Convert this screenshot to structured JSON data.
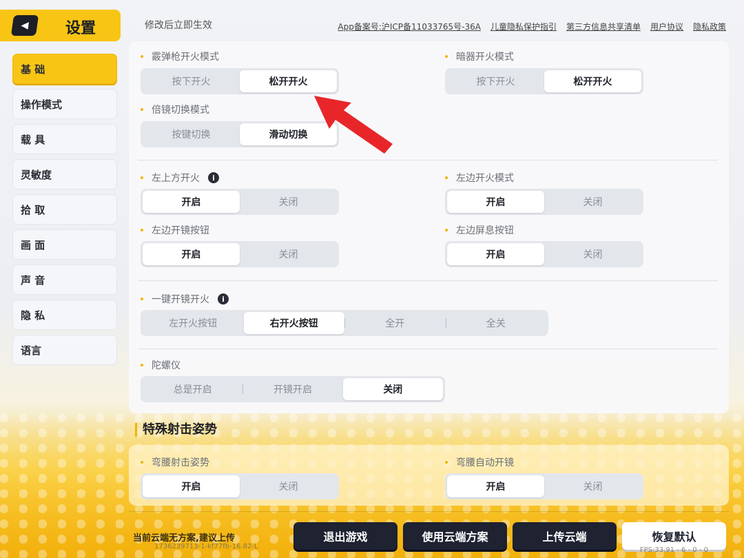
{
  "header": {
    "title": "设置",
    "hint": "修改后立即生效",
    "links": [
      "App备案号:沪ICP备11033765号-36A",
      "儿童隐私保护指引",
      "第三方信息共享清单",
      "用户协议",
      "隐私政策"
    ]
  },
  "sidebar": {
    "items": [
      "基 础",
      "操作模式",
      "载 具",
      "灵敏度",
      "拾 取",
      "画 面",
      "声 音",
      "隐 私",
      "语言"
    ],
    "active_index": 0
  },
  "settings": {
    "shotgun": {
      "label": "霰弹枪开火模式",
      "options": [
        "按下开火",
        "松开开火"
      ],
      "selected": 1
    },
    "throwable": {
      "label": "暗器开火模式",
      "options": [
        "按下开火",
        "松开开火"
      ],
      "selected": 1
    },
    "scope_switch": {
      "label": "倍镜切换模式",
      "options": [
        "按键切换",
        "滑动切换"
      ],
      "selected": 1
    },
    "top_left_fire": {
      "label": "左上方开火",
      "options": [
        "开启",
        "关闭"
      ],
      "selected": 0
    },
    "left_fire_mode": {
      "label": "左边开火模式",
      "options": [
        "开启",
        "关闭"
      ],
      "selected": 0
    },
    "left_scope_btn": {
      "label": "左边开镜按钮",
      "options": [
        "开启",
        "关闭"
      ],
      "selected": 0
    },
    "left_hold_breath": {
      "label": "左边屏息按钮",
      "options": [
        "开启",
        "关闭"
      ],
      "selected": 0
    },
    "one_tap_scope_fire": {
      "label": "一键开镜开火",
      "options": [
        "左开火按钮",
        "右开火按钮",
        "全开",
        "全关"
      ],
      "selected": 1
    },
    "gyro": {
      "label": "陀螺仪",
      "options": [
        "总是开启",
        "开镜开启",
        "关闭"
      ],
      "selected": 2
    }
  },
  "special": {
    "title": "特殊射击姿势",
    "crouch_stance": {
      "label": "弯腰射击姿势",
      "options": [
        "开启",
        "关闭"
      ],
      "selected": 0
    },
    "crouch_auto_scope": {
      "label": "弯腰自动开镜",
      "options": [
        "开启",
        "关闭"
      ],
      "selected": 0
    }
  },
  "footer": {
    "cloud_text": "当前云端无方案,建议上传",
    "cloud_id": "1736239713-1-kf77fb-16.82-L",
    "buttons": [
      "退出游戏",
      "使用云端方案",
      "上传云端",
      "恢复默认"
    ],
    "fps": "FPS:33.91 - 6 - 0 - 0"
  },
  "colors": {
    "accent": "#f8c515",
    "dark_button": "#1e2231",
    "annotation_arrow": "#e8262a"
  }
}
